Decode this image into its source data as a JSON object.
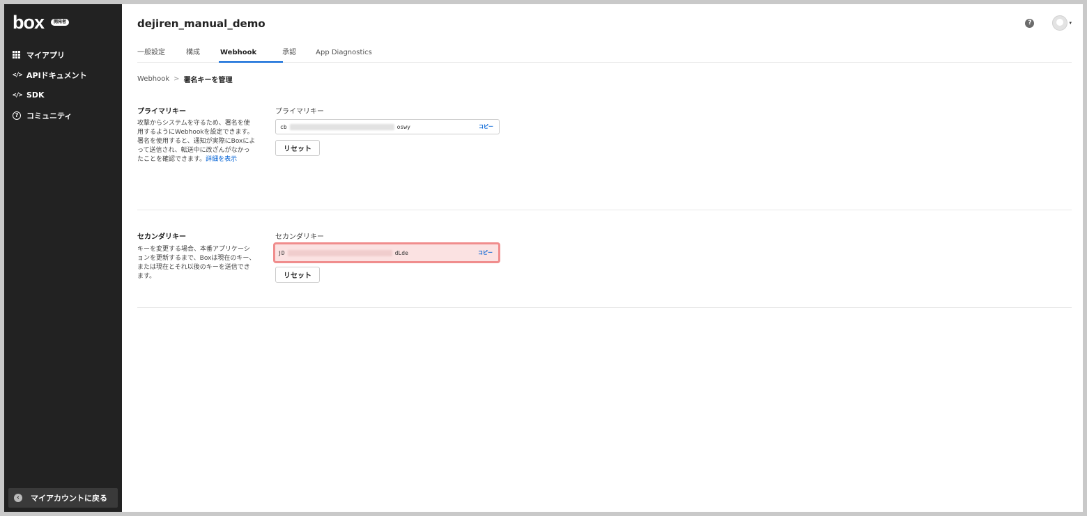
{
  "sidebar": {
    "logo": "box",
    "badge": "開発者",
    "items": [
      {
        "label": "マイアプリ",
        "icon": "grid-icon"
      },
      {
        "label": "APIドキュメント",
        "icon": "code-icon"
      },
      {
        "label": "SDK",
        "icon": "code-icon"
      },
      {
        "label": "コミュニティ",
        "icon": "help-circle-icon"
      }
    ],
    "back_label": "マイアカウントに戻る",
    "code_glyph": "</>",
    "help_glyph": "?",
    "back_glyph": "‹"
  },
  "header": {
    "title": "dejiren_manual_demo",
    "help_glyph": "?",
    "caret": "▾"
  },
  "tabs": [
    {
      "label": "一般設定",
      "active": false
    },
    {
      "label": "構成",
      "active": false
    },
    {
      "label": "Webhook",
      "active": true
    },
    {
      "label": "承認",
      "active": false
    },
    {
      "label": "App Diagnostics",
      "active": false
    }
  ],
  "breadcrumb": {
    "parent": "Webhook",
    "separator": ">",
    "current": "署名キーを管理"
  },
  "primary": {
    "title": "プライマリキー",
    "desc": "攻撃からシステムを守るため、署名を使用するようにWebhookを設定できます。署名を使用すると、通知が実際にBoxによって送信され、転送中に改ざんがなかったことを確認できます。",
    "link": "詳細を表示",
    "field_label": "プライマリキー",
    "key_start": "cb",
    "key_end": "oswy",
    "copy_label": "コピー",
    "reset_label": "リセット"
  },
  "secondary": {
    "title": "セカンダリキー",
    "desc": "キーを変更する場合、本番アプリケーションを更新するまで、Boxは現在のキー、または現在とそれ以後のキーを送信できます。",
    "field_label": "セカンダリキー",
    "key_start": "jD",
    "key_end": "dLde",
    "copy_label": "コピー",
    "reset_label": "リセット"
  },
  "colors": {
    "sidebar_bg": "#222222",
    "accent": "#0061d5",
    "highlight_border": "#f08d8d",
    "highlight_fill": "#fbe2e2"
  }
}
